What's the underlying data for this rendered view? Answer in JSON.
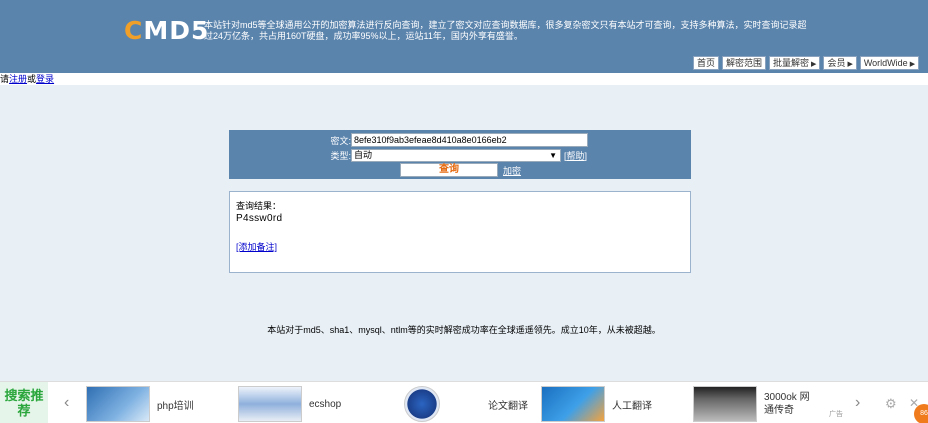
{
  "header": {
    "logo_c": "C",
    "logo_rest": "MD5",
    "intro": "本站针对md5等全球通用公开的加密算法进行反向查询，建立了密文对应查询数据库，很多复杂密文只有本站才可查询，支持多种算法，实时查询记录超过24万亿条，共占用160T硬盘，成功率95%以上，运站11年，国内外享有盛誉。",
    "nav": [
      {
        "label": "首页",
        "arrow": ""
      },
      {
        "label": "解密范围",
        "arrow": ""
      },
      {
        "label": "批量解密",
        "arrow": "▶"
      },
      {
        "label": "会员",
        "arrow": "▶"
      },
      {
        "label": "WorldWide",
        "arrow": "▶"
      }
    ]
  },
  "loginbar": {
    "prefix": "请",
    "register": "注册",
    "or": "或",
    "login": "登录"
  },
  "query": {
    "cipher_label": "密文:",
    "cipher_value": "8efe310f9ab3efeae8d410a8e0166eb2",
    "type_label": "类型:",
    "type_value": "自动",
    "help": "[帮助]",
    "submit": "查询",
    "encrypt": "加密"
  },
  "result": {
    "title": "查询结果：",
    "value": "P4ssw0rd",
    "add_note": "[添加备注]"
  },
  "footer": "本站对于md5、sha1、mysql、ntlm等的实时解密成功率在全球遥遥领先。成立10年，从未被超越。",
  "adbar": {
    "tag": "搜索推荐",
    "items": [
      {
        "label": "php培训",
        "icon": "php-training-thumb"
      },
      {
        "label": "ecshop",
        "icon": "ecshop-thumb"
      },
      {
        "label": "论文翻译",
        "icon": "globe-thumb"
      },
      {
        "label": "人工翻译",
        "icon": "translation-thumb"
      },
      {
        "label": "3000ok 网通传奇",
        "icon": "legend-thumb"
      }
    ],
    "ad_mark": "广告",
    "badge": "86"
  }
}
